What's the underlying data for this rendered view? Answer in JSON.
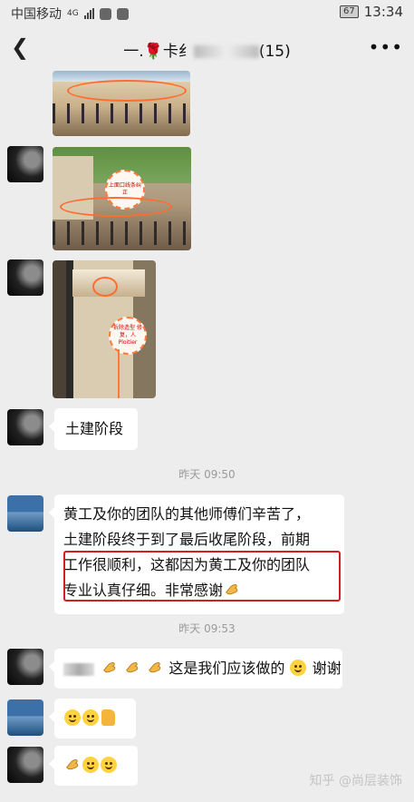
{
  "status": {
    "carrier": "中国移动",
    "network": "4G",
    "battery": "67",
    "time": "13:34"
  },
  "header": {
    "back_icon": "chevron-left-icon",
    "title_prefix": "一.🌹卡纟",
    "title_suffix": "(15)",
    "more_icon": "more-dots-icon"
  },
  "messages": {
    "image_note_1": "上面口线条纠正",
    "image_note_2": "拆除造型 修复，人 Ploitier",
    "civil_stage": "土建阶段",
    "time_1": "昨天 09:50",
    "long_lines": [
      "黄工及你的团队的其他师傅们辛苦了，",
      "土建阶段终于到了最后收尾阶段，前期",
      "工作很顺利，这都因为黄工及你的团队",
      "专业认真仔细。非常感谢"
    ],
    "time_2": "昨天 09:53",
    "reply": "这是我们应该做的",
    "reply_end": "谢谢"
  },
  "watermark": "知乎 @尚层装饰"
}
